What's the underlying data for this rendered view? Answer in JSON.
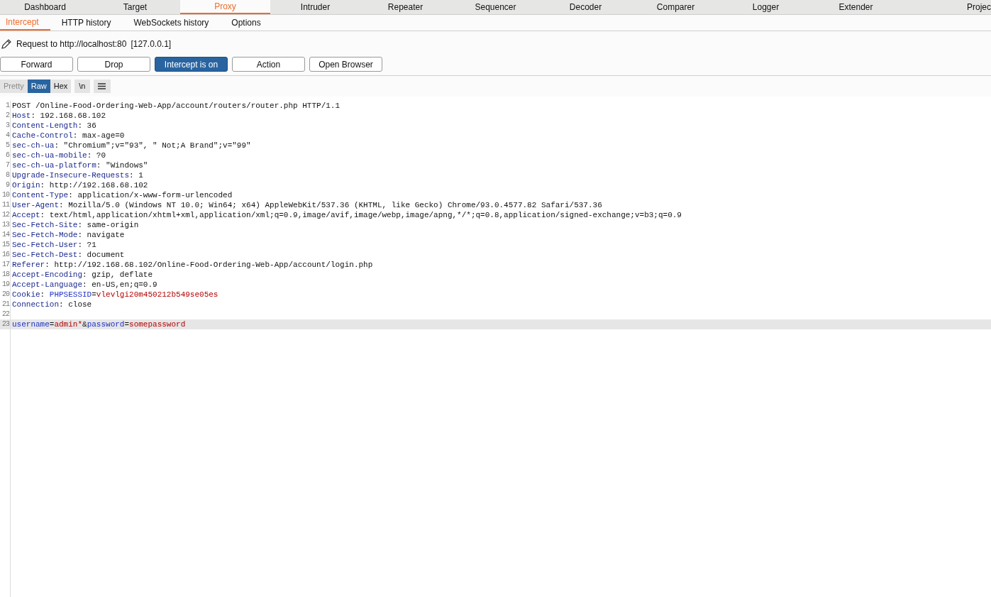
{
  "main_tabs": [
    {
      "label": "Dashboard",
      "selected": false
    },
    {
      "label": "Target",
      "selected": false
    },
    {
      "label": "Proxy",
      "selected": true
    },
    {
      "label": "Intruder",
      "selected": false
    },
    {
      "label": "Repeater",
      "selected": false
    },
    {
      "label": "Sequencer",
      "selected": false
    },
    {
      "label": "Decoder",
      "selected": false
    },
    {
      "label": "Comparer",
      "selected": false
    },
    {
      "label": "Logger",
      "selected": false
    },
    {
      "label": "Extender",
      "selected": false
    },
    {
      "label": "Projec",
      "selected": false
    }
  ],
  "sub_tabs": [
    {
      "label": "Intercept",
      "selected": true
    },
    {
      "label": "HTTP history",
      "selected": false
    },
    {
      "label": "WebSockets history",
      "selected": false
    },
    {
      "label": "Options",
      "selected": false
    }
  ],
  "request_info": {
    "target": "Request to http://localhost:80",
    "address": "[127.0.0.1]"
  },
  "actions": [
    {
      "label": "Forward",
      "on": false
    },
    {
      "label": "Drop",
      "on": false
    },
    {
      "label": "Intercept is on",
      "on": true
    },
    {
      "label": "Action",
      "on": false
    },
    {
      "label": "Open Browser",
      "on": false
    }
  ],
  "view_modes": [
    {
      "label": "Pretty",
      "selected": false,
      "disabled": true
    },
    {
      "label": "Raw",
      "selected": true,
      "disabled": false
    },
    {
      "label": "Hex",
      "selected": false,
      "disabled": false
    }
  ],
  "newline_toggle": "\\n",
  "editor_lines": [
    {
      "number": "1",
      "selected": false,
      "segments": [
        {
          "kind": "text",
          "text": "POST /Online-Food-Ordering-Web-App/account/routers/router.php HTTP/1.1"
        }
      ]
    },
    {
      "number": "2",
      "selected": false,
      "segments": [
        {
          "kind": "header",
          "text": "Host"
        },
        {
          "kind": "text",
          "text": ": 192.168.68.102"
        }
      ]
    },
    {
      "number": "3",
      "selected": false,
      "segments": [
        {
          "kind": "header",
          "text": "Content-Length"
        },
        {
          "kind": "text",
          "text": ": 36"
        }
      ]
    },
    {
      "number": "4",
      "selected": false,
      "segments": [
        {
          "kind": "header",
          "text": "Cache-Control"
        },
        {
          "kind": "text",
          "text": ": max-age=0"
        }
      ]
    },
    {
      "number": "5",
      "selected": false,
      "segments": [
        {
          "kind": "header",
          "text": "sec-ch-ua"
        },
        {
          "kind": "text",
          "text": ": \"Chromium\";v=\"93\", \" Not;A Brand\";v=\"99\""
        }
      ]
    },
    {
      "number": "6",
      "selected": false,
      "segments": [
        {
          "kind": "header",
          "text": "sec-ch-ua-mobile"
        },
        {
          "kind": "text",
          "text": ": ?0"
        }
      ]
    },
    {
      "number": "7",
      "selected": false,
      "segments": [
        {
          "kind": "header",
          "text": "sec-ch-ua-platform"
        },
        {
          "kind": "text",
          "text": ": \"Windows\""
        }
      ]
    },
    {
      "number": "8",
      "selected": false,
      "segments": [
        {
          "kind": "header",
          "text": "Upgrade-Insecure-Requests"
        },
        {
          "kind": "text",
          "text": ": 1"
        }
      ]
    },
    {
      "number": "9",
      "selected": false,
      "segments": [
        {
          "kind": "header",
          "text": "Origin"
        },
        {
          "kind": "text",
          "text": ": http://192.168.68.102"
        }
      ]
    },
    {
      "number": "10",
      "selected": false,
      "segments": [
        {
          "kind": "header",
          "text": "Content-Type"
        },
        {
          "kind": "text",
          "text": ": application/x-www-form-urlencoded"
        }
      ]
    },
    {
      "number": "11",
      "selected": false,
      "segments": [
        {
          "kind": "header",
          "text": "User-Agent"
        },
        {
          "kind": "text",
          "text": ": Mozilla/5.0 (Windows NT 10.0; Win64; x64) AppleWebKit/537.36 (KHTML, like Gecko) Chrome/93.0.4577.82 Safari/537.36"
        }
      ]
    },
    {
      "number": "12",
      "selected": false,
      "segments": [
        {
          "kind": "header",
          "text": "Accept"
        },
        {
          "kind": "text",
          "text": ": text/html,application/xhtml+xml,application/xml;q=0.9,image/avif,image/webp,image/apng,*/*;q=0.8,application/signed-exchange;v=b3;q=0.9"
        }
      ]
    },
    {
      "number": "13",
      "selected": false,
      "segments": [
        {
          "kind": "header",
          "text": "Sec-Fetch-Site"
        },
        {
          "kind": "text",
          "text": ": same-origin"
        }
      ]
    },
    {
      "number": "14",
      "selected": false,
      "segments": [
        {
          "kind": "header",
          "text": "Sec-Fetch-Mode"
        },
        {
          "kind": "text",
          "text": ": navigate"
        }
      ]
    },
    {
      "number": "15",
      "selected": false,
      "segments": [
        {
          "kind": "header",
          "text": "Sec-Fetch-User"
        },
        {
          "kind": "text",
          "text": ": ?1"
        }
      ]
    },
    {
      "number": "16",
      "selected": false,
      "segments": [
        {
          "kind": "header",
          "text": "Sec-Fetch-Dest"
        },
        {
          "kind": "text",
          "text": ": document"
        }
      ]
    },
    {
      "number": "17",
      "selected": false,
      "segments": [
        {
          "kind": "header",
          "text": "Referer"
        },
        {
          "kind": "text",
          "text": ": http://192.168.68.102/Online-Food-Ordering-Web-App/account/login.php"
        }
      ]
    },
    {
      "number": "18",
      "selected": false,
      "segments": [
        {
          "kind": "header",
          "text": "Accept-Encoding"
        },
        {
          "kind": "text",
          "text": ": gzip, deflate"
        }
      ]
    },
    {
      "number": "19",
      "selected": false,
      "segments": [
        {
          "kind": "header",
          "text": "Accept-Language"
        },
        {
          "kind": "text",
          "text": ": en-US,en;q=0.9"
        }
      ]
    },
    {
      "number": "20",
      "selected": false,
      "segments": [
        {
          "kind": "header",
          "text": "Cookie"
        },
        {
          "kind": "text",
          "text": ": "
        },
        {
          "kind": "param_name",
          "text": "PHPSESSID"
        },
        {
          "kind": "text",
          "text": "="
        },
        {
          "kind": "param_value",
          "text": "vlevlgi20m450212b549se05es"
        }
      ]
    },
    {
      "number": "21",
      "selected": false,
      "segments": [
        {
          "kind": "header",
          "text": "Connection"
        },
        {
          "kind": "text",
          "text": ": close"
        }
      ]
    },
    {
      "number": "22",
      "selected": false
    },
    {
      "number": "23",
      "selected": true,
      "segments": [
        {
          "kind": "param_name",
          "text": "username"
        },
        {
          "kind": "text",
          "text": "="
        },
        {
          "kind": "param_value",
          "text": "admin*"
        },
        {
          "kind": "text",
          "text": "&"
        },
        {
          "kind": "param_name",
          "text": "password"
        },
        {
          "kind": "text",
          "text": "="
        },
        {
          "kind": "param_value",
          "text": "somepassword"
        }
      ]
    }
  ]
}
